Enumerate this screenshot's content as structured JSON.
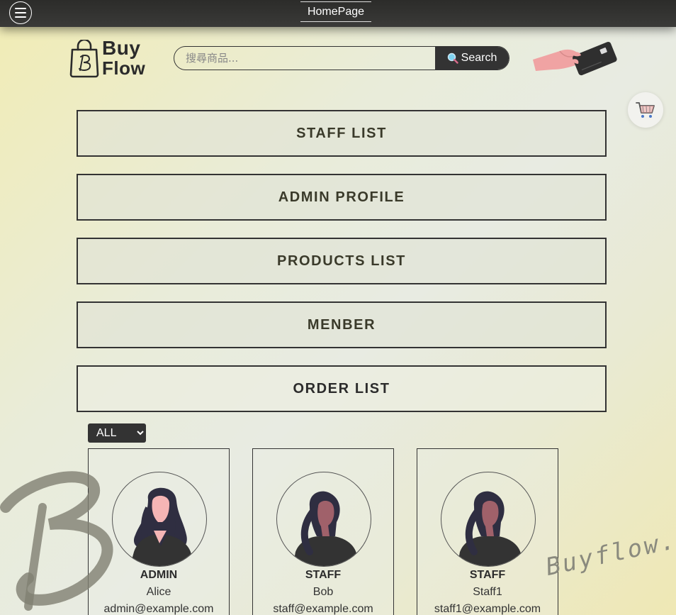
{
  "topbar": {
    "menu_icon": "hamburger-icon",
    "home_link": "HomePage"
  },
  "logo": {
    "line1": "Buy",
    "line2": "Flow",
    "icon": "shopping-bag-icon"
  },
  "search": {
    "placeholder": "搜尋商品...",
    "value": "",
    "button_label": "Search",
    "button_icon": "magnifier-icon"
  },
  "decor": {
    "card_icon": "hand-credit-card-icon",
    "cart_icon": "shopping-cart-icon"
  },
  "nav": {
    "items": [
      {
        "label": "STAFF LIST"
      },
      {
        "label": "ADMIN PROFILE"
      },
      {
        "label": "PRODUCTS LIST"
      },
      {
        "label": "MENBER"
      },
      {
        "label": "ORDER LIST"
      }
    ]
  },
  "filter": {
    "selected": "ALL",
    "options": [
      "ALL"
    ]
  },
  "staff": [
    {
      "role": "ADMIN",
      "name": "Alice",
      "email": "admin@example.com",
      "avatar": "woman-avatar-icon"
    },
    {
      "role": "STAFF",
      "name": "Bob",
      "email": "staff@example.com",
      "avatar": "woman-avatar-icon"
    },
    {
      "role": "STAFF",
      "name": "Staff1",
      "email": "staff1@example.com",
      "avatar": "woman-avatar-icon"
    }
  ],
  "watermark": {
    "text": "Buyflow."
  },
  "colors": {
    "dark": "#333333",
    "skin_light": "#f5b5b5",
    "skin_dark": "#a0616a",
    "hair": "#2f2e41"
  }
}
